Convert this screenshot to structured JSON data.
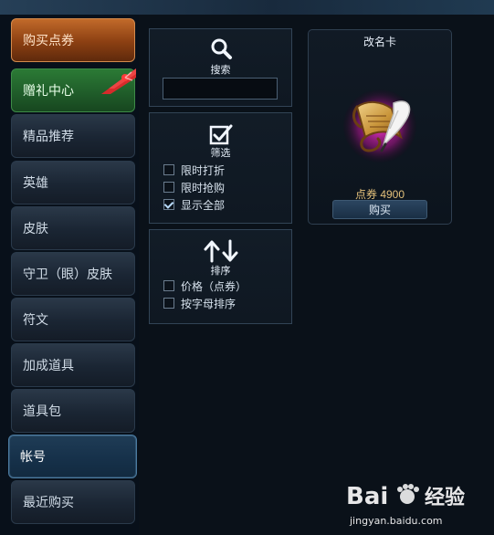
{
  "sidebar": {
    "items": [
      {
        "label": "购买点券"
      },
      {
        "label": "赠礼中心"
      },
      {
        "label": "精品推荐"
      },
      {
        "label": "英雄"
      },
      {
        "label": "皮肤"
      },
      {
        "label": "守卫（眼）皮肤"
      },
      {
        "label": "符文"
      },
      {
        "label": "加成道具"
      },
      {
        "label": "道具包"
      },
      {
        "label": "帐号"
      },
      {
        "label": "最近购买"
      }
    ],
    "selected_label": "帐号"
  },
  "search_panel": {
    "title": "搜索",
    "input_value": ""
  },
  "filter_panel": {
    "title": "筛选",
    "options": [
      {
        "label": "限时打折",
        "checked": false
      },
      {
        "label": "限时抢购",
        "checked": false
      },
      {
        "label": "显示全部",
        "checked": true
      }
    ]
  },
  "sort_panel": {
    "title": "排序",
    "options": [
      {
        "label": "价格（点券）",
        "checked": false
      },
      {
        "label": "按字母排序",
        "checked": false
      }
    ]
  },
  "product": {
    "title": "改名卡",
    "price": "点券 4900",
    "buy_label": "购买",
    "icon": "rename-card-scroll-quill-icon"
  },
  "watermark": {
    "logo_text": "Bai 经验",
    "url": "jingyan.baidu.com"
  },
  "colors": {
    "accent": "#4b7ba1",
    "orange_tab": "#c16a2a",
    "green_tab": "#2b7a35",
    "price_gold": "#e3c07a"
  }
}
